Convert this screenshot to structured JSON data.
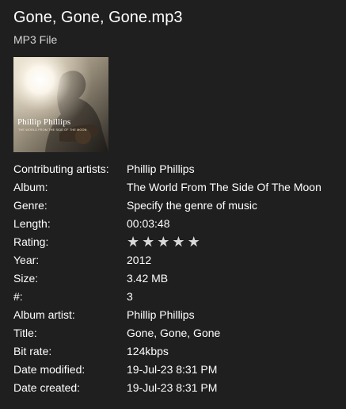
{
  "file": {
    "title": "Gone, Gone, Gone.mp3",
    "type": "MP3 File"
  },
  "cover": {
    "artist_text": "Phillip Phillips",
    "album_text": "THE WORLD FROM THE SIDE OF THE MOON"
  },
  "properties": [
    {
      "label": "Contributing artists:",
      "value": "Phillip Phillips"
    },
    {
      "label": "Album:",
      "value": "The World From The Side Of The Moon"
    },
    {
      "label": "Genre:",
      "value": "Specify the genre of music"
    },
    {
      "label": "Length:",
      "value": "00:03:48"
    },
    {
      "label": "Rating:",
      "value": ""
    },
    {
      "label": "Year:",
      "value": "2012"
    },
    {
      "label": "Size:",
      "value": "3.42 MB"
    },
    {
      "label": "#:",
      "value": "3"
    },
    {
      "label": "Album artist:",
      "value": "Phillip Phillips"
    },
    {
      "label": "Title:",
      "value": "Gone, Gone, Gone"
    },
    {
      "label": "Bit rate:",
      "value": "124kbps"
    },
    {
      "label": "Date modified:",
      "value": "19-Jul-23 8:31 PM"
    },
    {
      "label": "Date created:",
      "value": "19-Jul-23 8:31 PM"
    }
  ],
  "rating": {
    "stars_total": 5,
    "stars_filled": 0,
    "star_glyph": "★"
  },
  "colors": {
    "background": "#1f1f1f",
    "text": "#ffffff",
    "secondary_text": "#d6d6d6",
    "star": "#d9d9d9"
  }
}
